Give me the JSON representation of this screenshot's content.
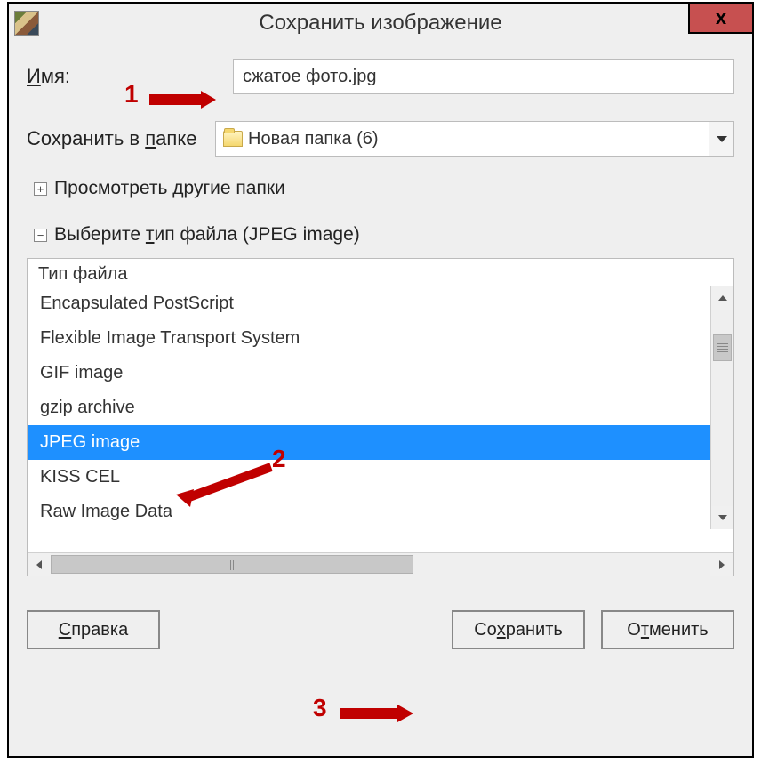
{
  "window": {
    "title": "Сохранить изображение",
    "close_label": "x"
  },
  "form": {
    "name_label": "Имя:",
    "name_value": "сжатое фото.jpg",
    "folder_label": "Сохранить в папке",
    "folder_value": "Новая папка (6)"
  },
  "sections": {
    "browse_folders": "Просмотреть другие папки",
    "choose_type": "Выберите тип файла (JPEG image)"
  },
  "type_list": {
    "header": "Тип файла",
    "items": [
      "Encapsulated PostScript",
      "Flexible Image Transport System",
      "GIF image",
      "gzip archive",
      "JPEG image",
      "KISS CEL",
      "Raw Image Data"
    ],
    "selected_index": 4
  },
  "buttons": {
    "help": "Справка",
    "save": "Сохранить",
    "cancel": "Отменить"
  },
  "annotations": {
    "n1": "1",
    "n2": "2",
    "n3": "3"
  }
}
